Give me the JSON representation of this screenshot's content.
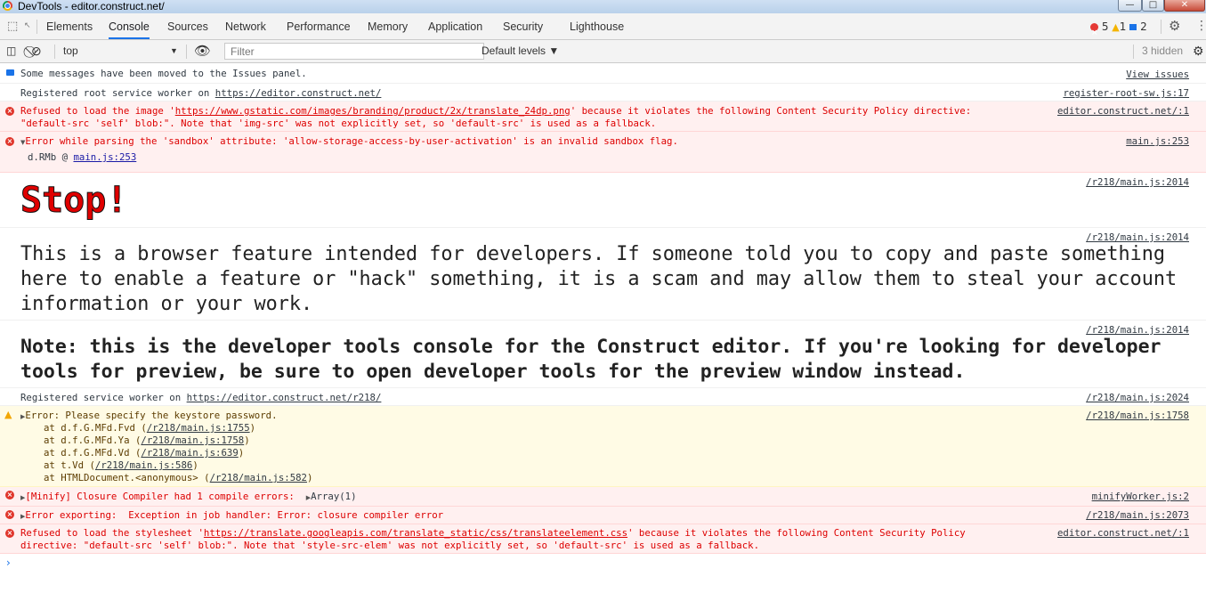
{
  "window": {
    "title": "DevTools - editor.construct.net/",
    "min_glyph": "—",
    "max_glyph": "□",
    "close_glyph": "✕"
  },
  "tabs": [
    {
      "label": "Elements"
    },
    {
      "label": "Console",
      "active": true
    },
    {
      "label": "Sources"
    },
    {
      "label": "Network"
    },
    {
      "label": "Performance"
    },
    {
      "label": "Memory"
    },
    {
      "label": "Application"
    },
    {
      "label": "Security"
    },
    {
      "label": "Lighthouse"
    }
  ],
  "counts": {
    "errors": "5",
    "warnings": "1",
    "messages": "2"
  },
  "toolbar": {
    "context": "top",
    "filter_placeholder": "Filter",
    "levels": "Default levels ▼",
    "hidden": "3 hidden"
  },
  "colors": {
    "accent": "#1a73e8",
    "error_bg": "#fff0f0",
    "warning_bg": "#fffbe5",
    "error_text": "#dd0000"
  },
  "messages": [
    {
      "type": "info",
      "text": "Some messages have been moved to the Issues panel.",
      "source": "View issues"
    },
    {
      "type": "log",
      "text": "Registered root service worker on ",
      "link": "https://editor.construct.net/",
      "source": "register-root-sw.js:17"
    },
    {
      "type": "error",
      "line1a": "Refused to load the image '",
      "link": "https://www.gstatic.com/images/branding/product/2x/translate_24dp.png",
      "line1b": "' because it violates the following Content Security Policy directive:",
      "line2": "\"default-src 'self' blob:\". Note that 'img-src' was not explicitly set, so 'default-src' is used as a fallback.",
      "source": "editor.construct.net/:1"
    },
    {
      "type": "error",
      "text": "Error while parsing the 'sandbox' attribute: 'allow-storage-access-by-user-activation' is an invalid sandbox flag.",
      "frame": "d.RMb @ ",
      "frame_link": "main.js:253",
      "source": "main.js:253"
    },
    {
      "type": "big",
      "text": "Stop!",
      "source": "/r218/main.js:2014"
    },
    {
      "type": "big",
      "text": "This is a browser feature intended for developers. If someone told you to copy and paste something here to enable a feature or \"hack\" something, it is a scam and may allow them to steal your account information or your work.",
      "source": "/r218/main.js:2014"
    },
    {
      "type": "big",
      "text": "Note: this is the developer tools console for the Construct editor. If you're looking for developer tools for preview, be sure to open developer tools for the preview window instead.",
      "source": "/r218/main.js:2014"
    },
    {
      "type": "log",
      "text": "Registered service worker on ",
      "link": "https://editor.construct.net/r218/",
      "source": "/r218/main.js:2024"
    },
    {
      "type": "warning",
      "text": "Error: Please specify the keystore password.",
      "source": "/r218/main.js:1758",
      "stack": [
        {
          "pre": "at d.f.G.MFd.Fvd (",
          "link": "/r218/main.js:1755",
          "post": ")"
        },
        {
          "pre": "at d.f.G.MFd.Ya (",
          "link": "/r218/main.js:1758",
          "post": ")"
        },
        {
          "pre": "at d.f.G.MFd.Vd (",
          "link": "/r218/main.js:639",
          "post": ")"
        },
        {
          "pre": "at t.Vd (",
          "link": "/r218/main.js:586",
          "post": ")"
        },
        {
          "pre": "at HTMLDocument.<anonymous> (",
          "link": "/r218/main.js:582",
          "post": ")"
        }
      ]
    },
    {
      "type": "error",
      "text": "[Minify] Closure Compiler had 1 compile errors:  ",
      "extra": "Array(1)",
      "source": "minifyWorker.js:2"
    },
    {
      "type": "error",
      "text": "Error exporting:  Exception in job handler: Error: closure compiler error",
      "source": "/r218/main.js:2073"
    },
    {
      "type": "error",
      "line1a": "Refused to load the stylesheet '",
      "link": "https://translate.googleapis.com/translate_static/css/translateelement.css",
      "line1b": "' because it violates the following Content Security Policy",
      "line2": "directive: \"default-src 'self' blob:\". Note that 'style-src-elem' was not explicitly set, so 'default-src' is used as a fallback.",
      "source": "editor.construct.net/:1"
    }
  ],
  "prompt_glyph": "›"
}
